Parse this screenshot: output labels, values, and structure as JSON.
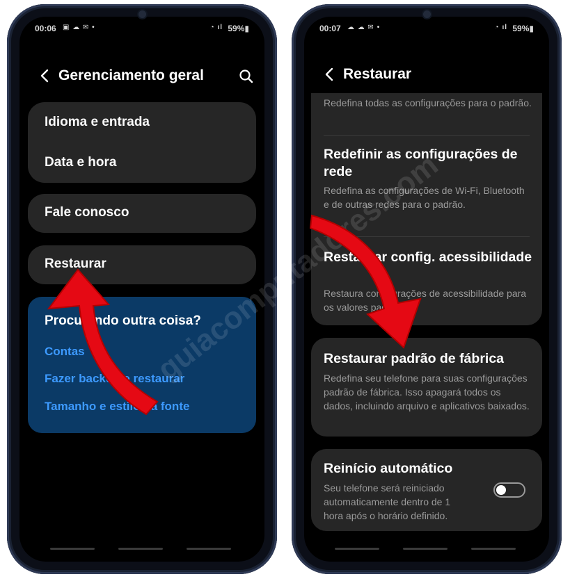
{
  "left_phone": {
    "status": {
      "time": "00:06",
      "icons_left": "▣ ☁ ✉ •",
      "icons_right": "◔ ıl",
      "battery": "59%▮"
    },
    "title": "Gerenciamento geral",
    "groups": [
      {
        "items": [
          {
            "label": "Idioma e entrada"
          },
          {
            "label": "Data e hora"
          }
        ]
      },
      {
        "items": [
          {
            "label": "Fale conosco"
          }
        ]
      },
      {
        "items": [
          {
            "label": "Restaurar"
          }
        ]
      }
    ],
    "suggestions": {
      "title": "Procurando outra coisa?",
      "links": [
        "Contas",
        "Fazer backup e restaurar",
        "Tamanho e estilo da fonte"
      ]
    },
    "icons": {
      "back": "chevron-left-icon",
      "search": "search-icon"
    }
  },
  "right_phone": {
    "status": {
      "time": "00:07",
      "icons_left": "☁ ☁ ✉ •",
      "icons_right": "◔ ıl",
      "battery": "59%▮"
    },
    "title": "Restaurar",
    "items": [
      {
        "title": "",
        "desc": "Redefina todas as configurações para o padrão."
      },
      {
        "title": "Redefinir as configurações de rede",
        "desc": "Redefina as configurações de Wi-Fi, Bluetooth e de outras redes para o padrão."
      },
      {
        "title": "Restaurar config. acessibilidade",
        "desc": "Restaura configurações de acessibilidade para os valores padrão."
      },
      {
        "title": "Restaurar padrão de fábrica",
        "desc": "Redefina seu telefone para suas configurações padrão de fábrica. Isso apagará todos os dados, incluindo arquivo e aplicativos baixados."
      },
      {
        "title": "Reinício automático",
        "desc": "Seu telefone será reiniciado automaticamente dentro de 1 hora após o horário definido.",
        "toggle": false
      }
    ]
  },
  "watermark": "guiacomputadores.com",
  "colors": {
    "accent_link": "#3d9aff",
    "suggestion_bg": "#0b3a66",
    "card_bg": "#262626",
    "arrow": "#e50914"
  }
}
